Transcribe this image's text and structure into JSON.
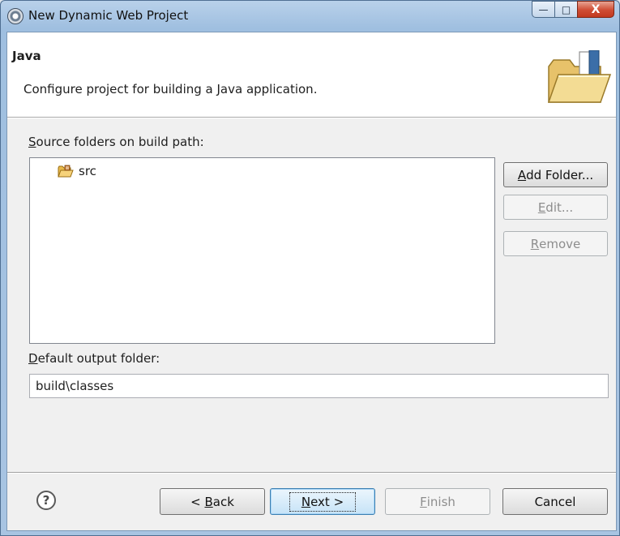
{
  "window": {
    "title": "New Dynamic Web Project",
    "min_glyph": "—",
    "max_glyph": "□",
    "close_glyph": "X"
  },
  "header": {
    "title": "Java",
    "description": "Configure project for building a Java application.",
    "icon": "folder-icon"
  },
  "source": {
    "label_accel": "S",
    "label_rest": "ource folders on build path:",
    "items": [
      {
        "label": "src",
        "icon": "source-package-icon"
      }
    ]
  },
  "side_buttons": {
    "add_accel": "A",
    "add_rest": "dd Folder...",
    "edit_accel": "E",
    "edit_rest": "dit...",
    "remove_accel": "R",
    "remove_rest": "emove"
  },
  "output": {
    "label_accel": "D",
    "label_rest": "efault output folder:",
    "value": "build\\classes"
  },
  "footer": {
    "help_glyph": "?",
    "back_pre": "< ",
    "back_accel": "B",
    "back_rest": "ack",
    "next_accel": "N",
    "next_rest": "ext >",
    "finish_accel": "F",
    "finish_rest": "inish",
    "cancel": "Cancel"
  }
}
